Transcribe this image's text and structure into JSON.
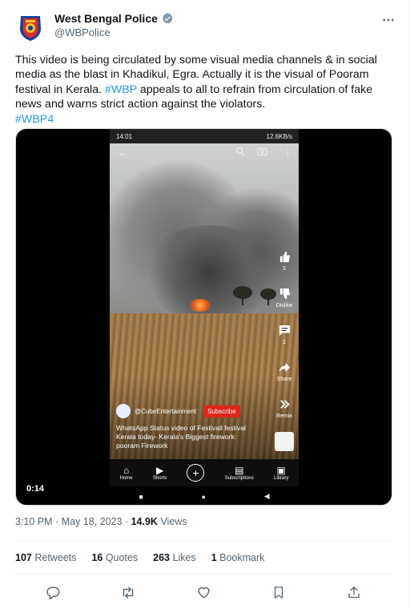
{
  "author": {
    "name": "West Bengal Police",
    "handle": "@WBPolice",
    "verified": true,
    "verified_color": "#829aab"
  },
  "tweet": {
    "text_1": "This video is being circulated by some visual media channels & in social media as the blast in Khadikul, Egra. Actually it is the visual of Pooram festival in Kerala. ",
    "hashtag_1": "#WBP",
    "text_2": " appeals to all to refrain from circulation of fake news and warns strict action against the violators.",
    "hashtag_2": "#WBP4"
  },
  "video": {
    "duration": "0:14",
    "status_time": "14:01",
    "status_right": "12.6KB/s",
    "side_buttons": [
      {
        "icon": "thumbs-up-icon",
        "label": "5"
      },
      {
        "icon": "thumbs-down-icon",
        "label": "Dislike"
      },
      {
        "icon": "comment-icon",
        "label": "1"
      },
      {
        "icon": "share-icon",
        "label": "Share"
      },
      {
        "icon": "remix-icon",
        "label": "Remix"
      }
    ],
    "channel": "@CubeEntertainment",
    "subscribe_label": "Subscribe",
    "caption": "WhatsApp Status video of Festivall festival Kerala today- Kerala's Biggest firework: pooram Firework",
    "nav": [
      {
        "icon": "home-icon",
        "label": "Home"
      },
      {
        "icon": "shorts-icon",
        "label": "Shorts"
      },
      {
        "icon": "plus-icon",
        "label": ""
      },
      {
        "icon": "subscriptions-icon",
        "label": "Subscriptions"
      },
      {
        "icon": "library-icon",
        "label": "Library"
      }
    ]
  },
  "meta": {
    "time": "3:10 PM",
    "separator": "·",
    "date": "May 18, 2023",
    "views_count": "14.9K",
    "views_label": "Views"
  },
  "stats": {
    "retweets_count": "107",
    "retweets_label": "Retweets",
    "quotes_count": "16",
    "quotes_label": "Quotes",
    "likes_count": "263",
    "likes_label": "Likes",
    "bookmarks_count": "1",
    "bookmarks_label": "Bookmark"
  },
  "colors": {
    "accent": "#1d9bf0",
    "secondary_text": "#536471",
    "subscribe_red": "#e1251b"
  }
}
